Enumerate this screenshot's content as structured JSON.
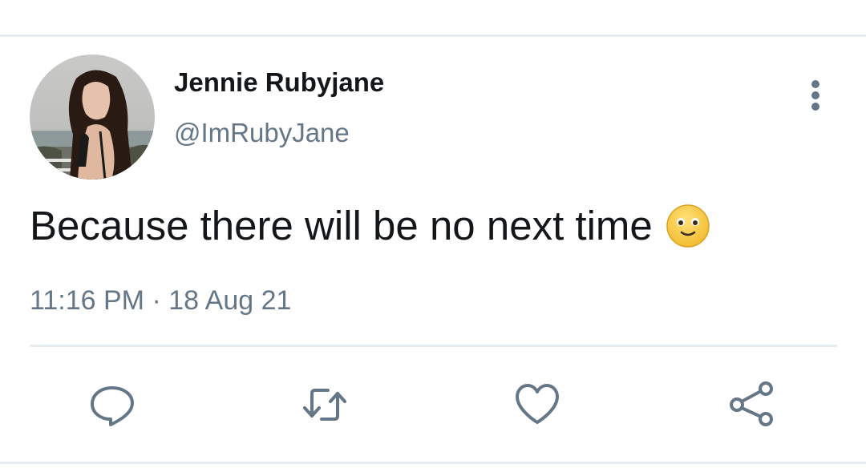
{
  "tweet": {
    "author": {
      "display_name": "Jennie Rubyjane",
      "handle": "@ImRubyJane"
    },
    "text": "Because there will be no next time",
    "emoji": "slightly-smiling-face",
    "time": "11:16 PM",
    "separator": "·",
    "date": "18 Aug 21"
  },
  "actions": {
    "reply_icon": "reply-icon",
    "retweet_icon": "retweet-icon",
    "like_icon": "heart-icon",
    "share_icon": "share-icon",
    "more_icon": "more-vertical-icon"
  },
  "colors": {
    "primary_text": "#14171a",
    "secondary_text": "#657786",
    "divider": "#e6ecf0"
  }
}
